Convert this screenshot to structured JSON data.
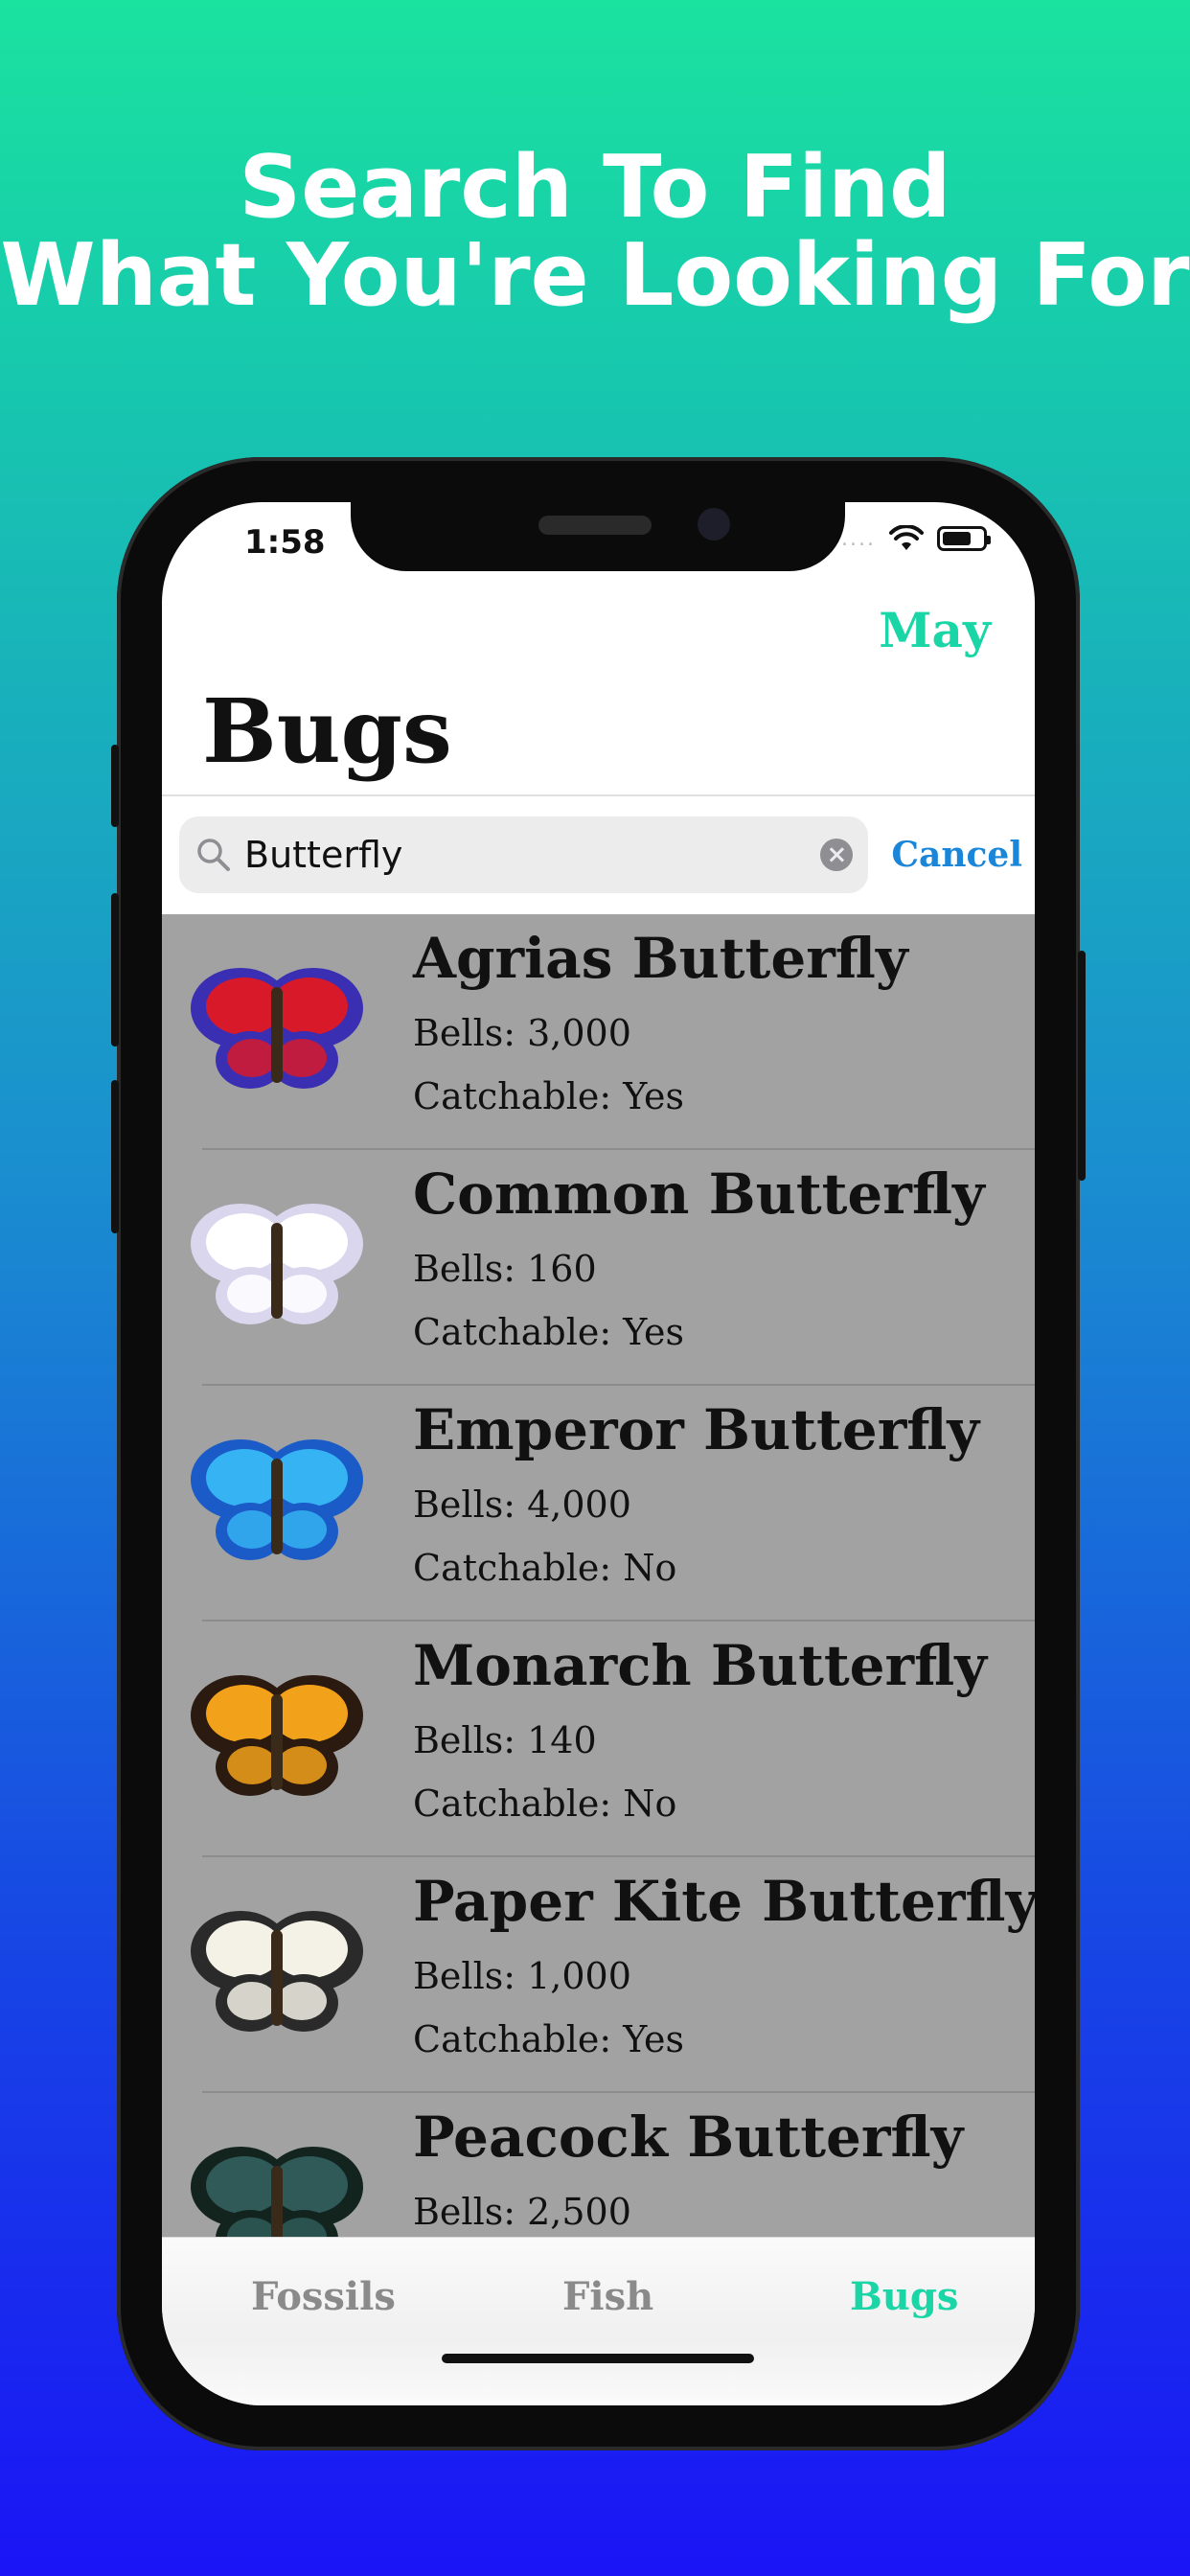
{
  "headline": {
    "line1": "Search To Find",
    "line2": "What You're Looking For"
  },
  "status_bar": {
    "time": "1:58",
    "signal": "....",
    "wifi_icon": "wifi-icon",
    "battery_icon": "battery-icon"
  },
  "nav": {
    "month_button": "May",
    "title": "Bugs"
  },
  "search": {
    "value": "Butterfly",
    "placeholder": "Search",
    "cancel_label": "Cancel"
  },
  "items": [
    {
      "name": "Agrias Butterfly",
      "bells": "Bells: 3,000",
      "catchable": "Catchable: Yes",
      "colors": [
        "#d8192a",
        "#3a2fb2"
      ]
    },
    {
      "name": "Common Butterfly",
      "bells": "Bells: 160",
      "catchable": "Catchable: Yes",
      "colors": [
        "#ffffff",
        "#d9d6ee"
      ]
    },
    {
      "name": "Emperor Butterfly",
      "bells": "Bells: 4,000",
      "catchable": "Catchable: No",
      "colors": [
        "#35b3f2",
        "#1a5bc8"
      ]
    },
    {
      "name": "Monarch Butterfly",
      "bells": "Bells: 140",
      "catchable": "Catchable: No",
      "colors": [
        "#f2a21a",
        "#2a1a10"
      ]
    },
    {
      "name": "Paper Kite Butterfly",
      "bells": "Bells: 1,000",
      "catchable": "Catchable: Yes",
      "colors": [
        "#f4f1e6",
        "#2a2a2a"
      ]
    },
    {
      "name": "Peacock Butterfly",
      "bells": "Bells: 2,500",
      "catchable": "",
      "colors": [
        "#2f5a58",
        "#13241f"
      ]
    }
  ],
  "tabs": [
    {
      "label": "Fossils",
      "active": false
    },
    {
      "label": "Fish",
      "active": false
    },
    {
      "label": "Bugs",
      "active": true
    }
  ],
  "colors": {
    "accent": "#1ad6a6",
    "link": "#1a86d9",
    "tab_inactive": "#8a8a8a",
    "list_bg": "#a2a2a2"
  }
}
